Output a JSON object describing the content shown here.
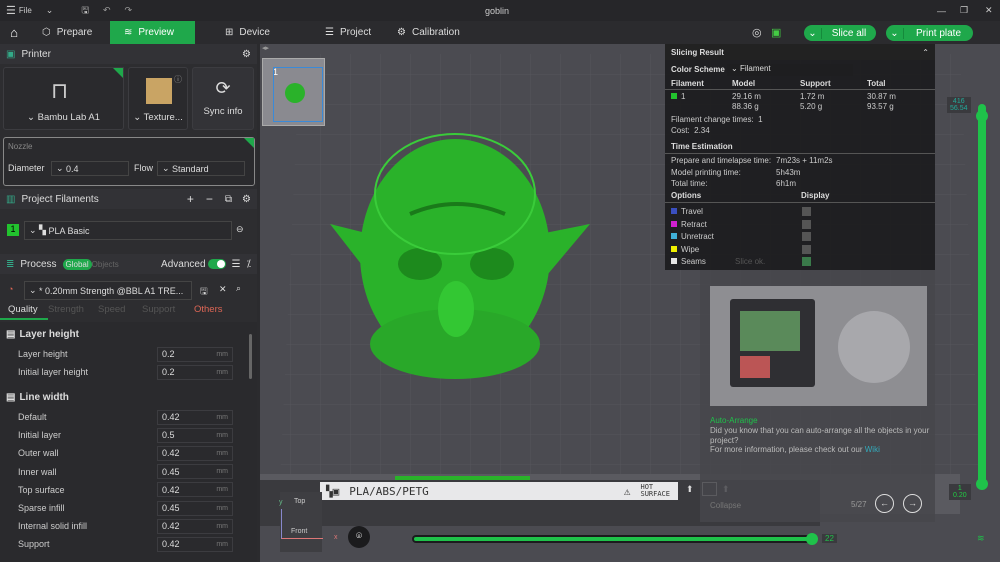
{
  "titlebar": {
    "menu": "File",
    "title": "goblin"
  },
  "tabs": [
    {
      "label": "Prepare"
    },
    {
      "label": "Preview"
    },
    {
      "label": "Device"
    },
    {
      "label": "Project"
    },
    {
      "label": "Calibration"
    }
  ],
  "actions": {
    "slice_all": "Slice all",
    "print_plate": "Print plate"
  },
  "printer": {
    "section": "Printer",
    "name": "Bambu Lab A1",
    "plate": "Texture...",
    "sync": "Sync info",
    "nozzle_label": "Nozzle",
    "diameter_label": "Diameter",
    "diameter": "0.4",
    "flow_label": "Flow",
    "flow": "Standard"
  },
  "filaments": {
    "section": "Project Filaments",
    "items": [
      {
        "index": "1",
        "name": "PLA Basic",
        "color": "#22c32e"
      }
    ]
  },
  "process": {
    "section": "Process",
    "global": "Global",
    "objects": "Objects",
    "advanced": "Advanced",
    "profile": "* 0.20mm Strength @BBL A1 TRE...",
    "tabs": [
      "Quality",
      "Strength",
      "Speed",
      "Support",
      "Others"
    ],
    "groups": [
      {
        "title": "Layer height",
        "rows": [
          {
            "label": "Layer height",
            "value": "0.2",
            "unit": "mm"
          },
          {
            "label": "Initial layer height",
            "value": "0.2",
            "unit": "mm"
          }
        ]
      },
      {
        "title": "Line width",
        "rows": [
          {
            "label": "Default",
            "value": "0.42",
            "unit": "mm"
          },
          {
            "label": "Initial layer",
            "value": "0.5",
            "unit": "mm"
          },
          {
            "label": "Outer wall",
            "value": "0.42",
            "unit": "mm"
          },
          {
            "label": "Inner wall",
            "value": "0.45",
            "unit": "mm"
          },
          {
            "label": "Top surface",
            "value": "0.42",
            "unit": "mm"
          },
          {
            "label": "Sparse infill",
            "value": "0.45",
            "unit": "mm"
          },
          {
            "label": "Internal solid infill",
            "value": "0.42",
            "unit": "mm"
          },
          {
            "label": "Support",
            "value": "0.42",
            "unit": "mm"
          }
        ]
      }
    ]
  },
  "plate": {
    "number": "1"
  },
  "slicing": {
    "title": "Slicing Result",
    "color_scheme_label": "Color Scheme",
    "color_scheme": "Filament",
    "headers": [
      "Filament",
      "Model",
      "Support",
      "Total"
    ],
    "row": {
      "id": "1",
      "model_len": "29.16 m",
      "model_wt": "88.36 g",
      "support_len": "1.72 m",
      "support_wt": "5.20 g",
      "total_len": "30.87 m",
      "total_wt": "93.57 g"
    },
    "change_times": "Filament change times:  1",
    "cost": "Cost:  2.34",
    "time_title": "Time Estimation",
    "prepare_label": "Prepare and timelapse time:",
    "prepare": "7m23s + 11m2s",
    "model_time_label": "Model printing time:",
    "model_time": "5h43m",
    "total_label": "Total time:",
    "total": "6h1m",
    "options_label": "Options",
    "display_label": "Display",
    "options": [
      {
        "label": "Travel",
        "color": "#3a4fc0"
      },
      {
        "label": "Retract",
        "color": "#d020d0"
      },
      {
        "label": "Unretract",
        "color": "#40b0d8"
      },
      {
        "label": "Wipe",
        "color": "#f0f000"
      },
      {
        "label": "Seams",
        "color": "#e6e6e6"
      }
    ],
    "slice_ok": "Slice ok."
  },
  "tip": {
    "title": "Auto-Arrange",
    "body1": "Did you know that you can auto-arrange all the objects in your project?",
    "body2": "For more information, please check out our ",
    "link": "Wiki",
    "page": "5/27",
    "collapse": "Collapse"
  },
  "bed": {
    "label": "PLA/ABS/PETG",
    "hot1": "HOT",
    "hot2": "SURFACE"
  },
  "axes": {
    "top": "Top",
    "front": "Front",
    "x": "x",
    "y": "y"
  },
  "layer_slider": {
    "top_layer": "416",
    "top_height": "56.54",
    "bottom_layer": "1",
    "bottom_height": "0.20"
  },
  "move_slider": {
    "value": "22"
  }
}
